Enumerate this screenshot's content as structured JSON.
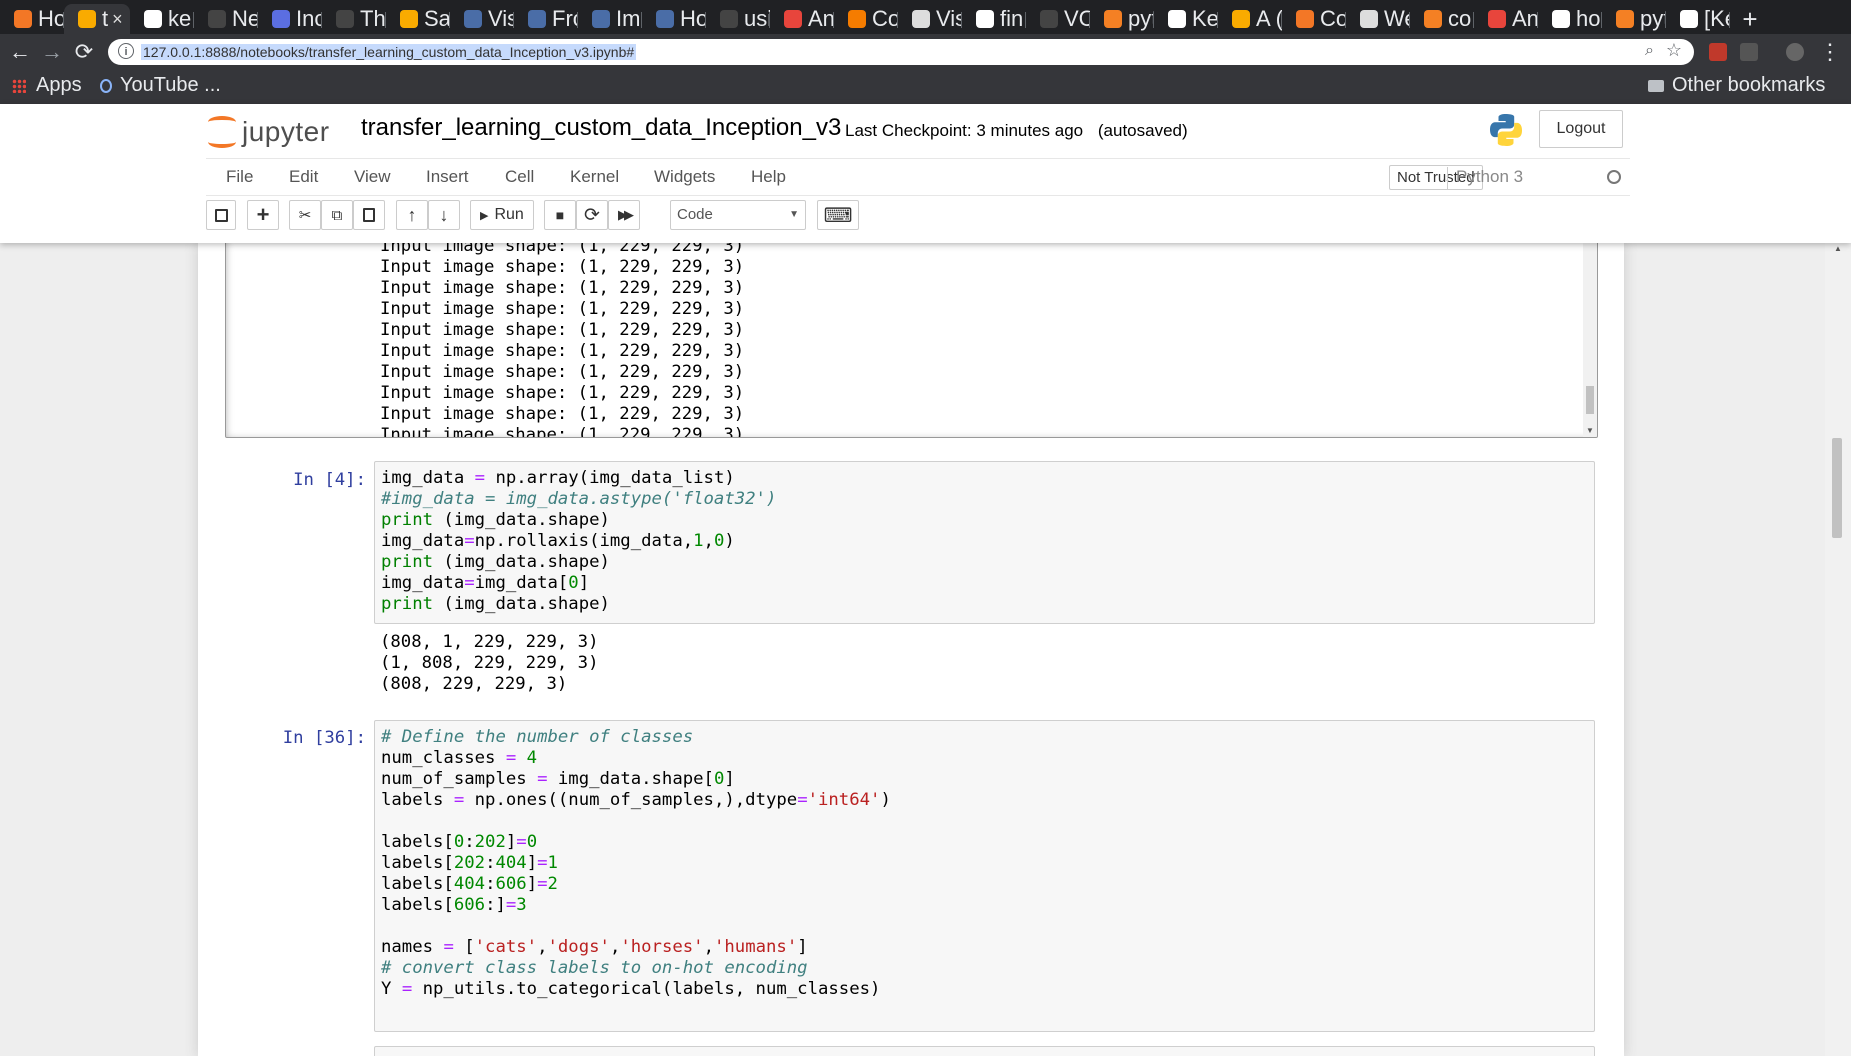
{
  "browser": {
    "tabs": [
      {
        "title": "Ho",
        "color": "#f37726"
      },
      {
        "title": "t",
        "color": "#f9ab00",
        "active": true
      },
      {
        "title": "ke",
        "color": "#ffffff"
      },
      {
        "title": "Ne",
        "color": "#444444"
      },
      {
        "title": "Inc",
        "color": "#5b6ee1"
      },
      {
        "title": "Th",
        "color": "#444444"
      },
      {
        "title": "Sa",
        "color": "#f9ab00"
      },
      {
        "title": "Vis",
        "color": "#4a6da7"
      },
      {
        "title": "Fro",
        "color": "#4a6da7"
      },
      {
        "title": "Im",
        "color": "#4a6da7"
      },
      {
        "title": "Ho",
        "color": "#4a6da7"
      },
      {
        "title": "usi",
        "color": "#444444"
      },
      {
        "title": "An",
        "color": "#e8453c"
      },
      {
        "title": "Co",
        "color": "#f57c00"
      },
      {
        "title": "Vis",
        "color": "#dddddd"
      },
      {
        "title": "fin",
        "color": "#ffffff"
      },
      {
        "title": "VC",
        "color": "#444444"
      },
      {
        "title": "pyt",
        "color": "#f48024"
      },
      {
        "title": "Ke",
        "color": "#ffffff"
      },
      {
        "title": "A (",
        "color": "#f9ab00"
      },
      {
        "title": "Co",
        "color": "#f37726"
      },
      {
        "title": "We",
        "color": "#dddddd"
      },
      {
        "title": "co",
        "color": "#f48024"
      },
      {
        "title": "An",
        "color": "#e8453c"
      },
      {
        "title": "ho",
        "color": "#ffffff"
      },
      {
        "title": "pyt",
        "color": "#f48024"
      },
      {
        "title": "[Ke",
        "color": "#ffffff"
      }
    ],
    "active_tab_close": "×",
    "new_tab": "+",
    "back_icon": "←",
    "forward_icon": "→",
    "reload_icon": "⟳",
    "url": "127.0.0.1:8888/notebooks/transfer_learning_custom_data_Inception_v3.ipynb#",
    "info_icon": "i",
    "zoom_icon": "⌕",
    "star_icon": "☆",
    "menu_icon": "⋮",
    "bookmarks": {
      "apps_label": "Apps",
      "youtube_label": "YouTube ...",
      "other_label": "Other bookmarks"
    }
  },
  "header": {
    "logo_text": "jupyter",
    "notebook_name": "transfer_learning_custom_data_Inception_v3",
    "checkpoint": "Last Checkpoint: 3 minutes ago",
    "autosave": "(autosaved)",
    "logout_label": "Logout"
  },
  "menubar": {
    "items": [
      "File",
      "Edit",
      "View",
      "Insert",
      "Cell",
      "Kernel",
      "Widgets",
      "Help"
    ],
    "trust_label": "Not Trusted",
    "kernel_name": "Python 3"
  },
  "toolbar": {
    "save_icon": "💾",
    "add_icon": "+",
    "cut_icon": "✂",
    "copy_icon": "⧉",
    "paste_icon": "📋",
    "up_icon": "🡑",
    "down_icon": "🡓",
    "run_label": "Run",
    "run_icon": "▶",
    "stop_icon": "■",
    "restart_icon": "⟳",
    "fast_forward_icon": "⏩",
    "cell_type": "Code",
    "keyboard_icon": "⌨"
  },
  "cells": {
    "scrolled_output_lines": [
      "Input image shape: (1, 229, 229, 3)",
      "Input image shape: (1, 229, 229, 3)",
      "Input image shape: (1, 229, 229, 3)",
      "Input image shape: (1, 229, 229, 3)",
      "Input image shape: (1, 229, 229, 3)",
      "Input image shape: (1, 229, 229, 3)",
      "Input image shape: (1, 229, 229, 3)",
      "Input image shape: (1, 229, 229, 3)",
      "Input image shape: (1, 229, 229, 3)",
      "Input image shape: (1, 229, 229, 3)"
    ],
    "cell4": {
      "prompt": "In [4]:",
      "output": [
        "(808, 1, 229, 229, 3)",
        "(1, 808, 229, 229, 3)",
        "(808, 229, 229, 3)"
      ]
    },
    "cell36": {
      "prompt": "In [36]:"
    }
  },
  "colors": {
    "jupyter_orange": "#f37726",
    "prompt_blue": "#303f9f",
    "code_keyword": "#008000",
    "code_comment": "#408080",
    "code_string": "#ba2121"
  }
}
